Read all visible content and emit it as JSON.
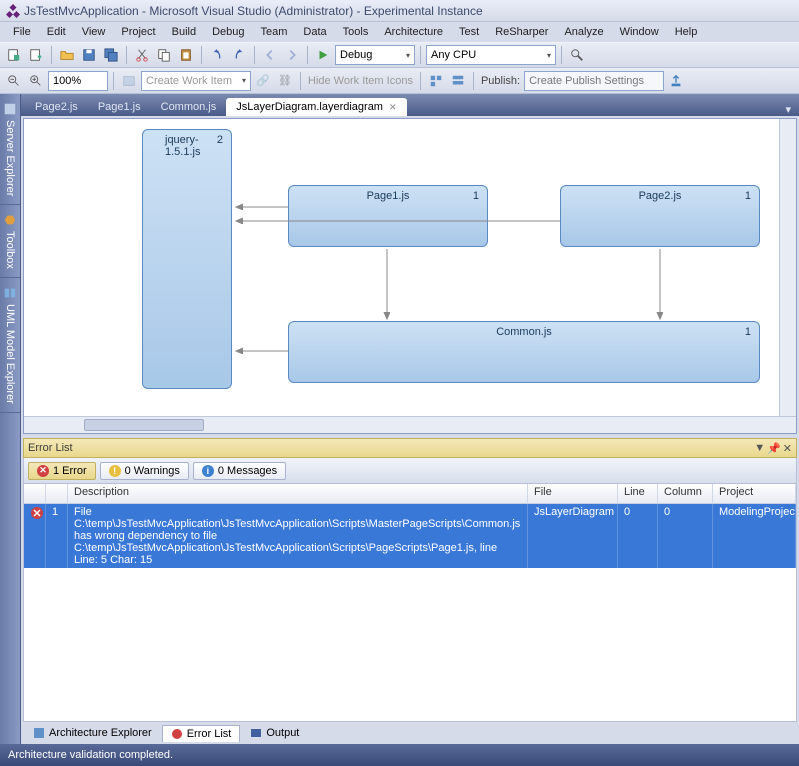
{
  "title": "JsTestMvcApplication - Microsoft Visual Studio (Administrator) - Experimental Instance",
  "menu": [
    "File",
    "Edit",
    "View",
    "Project",
    "Build",
    "Debug",
    "Team",
    "Data",
    "Tools",
    "Architecture",
    "Test",
    "ReSharper",
    "Analyze",
    "Window",
    "Help"
  ],
  "toolbar": {
    "config": "Debug",
    "platform": "Any CPU"
  },
  "toolbar2": {
    "zoom": "100%",
    "create_work": "Create Work Item",
    "hide_icons": "Hide Work Item Icons",
    "publish": "Publish:",
    "publish_settings": "Create Publish Settings"
  },
  "side_tabs": [
    "Server Explorer",
    "Toolbox",
    "UML Model Explorer"
  ],
  "doc_tabs": [
    {
      "label": "Page2.js",
      "active": false
    },
    {
      "label": "Page1.js",
      "active": false
    },
    {
      "label": "Common.js",
      "active": false
    },
    {
      "label": "JsLayerDiagram.layerdiagram",
      "active": true
    }
  ],
  "diagram": {
    "nodes": [
      {
        "id": "jquery",
        "label": "jquery-1.5.1.js",
        "num": "2"
      },
      {
        "id": "page1",
        "label": "Page1.js",
        "num": "1"
      },
      {
        "id": "page2",
        "label": "Page2.js",
        "num": "1"
      },
      {
        "id": "common",
        "label": "Common.js",
        "num": "1"
      }
    ]
  },
  "error_panel": {
    "title": "Error List",
    "filters": {
      "errors": "1 Error",
      "warnings": "0 Warnings",
      "messages": "0 Messages"
    },
    "columns": [
      "",
      "",
      "Description",
      "File",
      "Line",
      "Column",
      "Project"
    ],
    "row": {
      "num": "1",
      "description": "File C:\\temp\\JsTestMvcApplication\\JsTestMvcApplication\\Scripts\\MasterPageScripts\\Common.js has wrong dependency to file C:\\temp\\JsTestMvcApplication\\JsTestMvcApplication\\Scripts\\PageScripts\\Page1.js, line Line: 5 Char: 15",
      "file": "JsLayerDiagram",
      "line": "0",
      "column": "0",
      "project": "ModelingProject"
    }
  },
  "bottom_tabs": [
    "Architecture Explorer",
    "Error List",
    "Output"
  ],
  "status": "Architecture validation completed."
}
